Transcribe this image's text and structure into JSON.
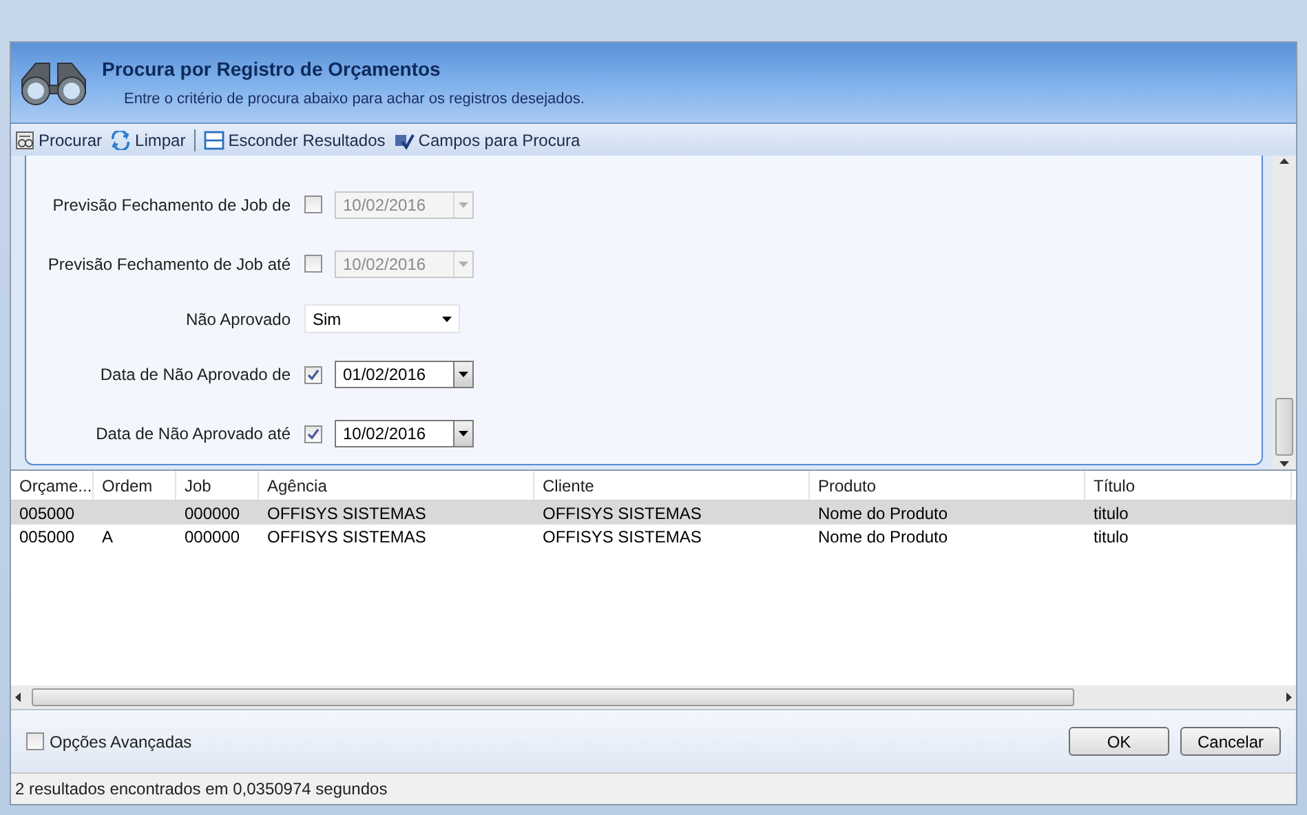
{
  "header": {
    "title": "Procura por Registro de Orçamentos",
    "subtitle": "Entre o critério de procura abaixo para achar os registros desejados."
  },
  "toolbar": [
    {
      "label": "Procurar"
    },
    {
      "label": "Limpar"
    },
    {
      "label": "Esconder Resultados"
    },
    {
      "label": "Campos para Procura"
    }
  ],
  "criteria": [
    {
      "kind": "date",
      "label": "Previsão Fechamento de Job de",
      "checked": false,
      "value": "10/02/2016"
    },
    {
      "kind": "date",
      "label": "Previsão Fechamento de Job até",
      "checked": false,
      "value": "10/02/2016"
    },
    {
      "kind": "combo",
      "label": "Não Aprovado",
      "value": "Sim"
    },
    {
      "kind": "date",
      "label": "Data de Não Aprovado de",
      "checked": true,
      "value": "01/02/2016"
    },
    {
      "kind": "date",
      "label": "Data de Não Aprovado até",
      "checked": true,
      "value": "10/02/2016"
    }
  ],
  "table": {
    "columns": [
      "Orçame...",
      "Ordem",
      "Job",
      "Agência",
      "Cliente",
      "Produto",
      "Título"
    ],
    "rows": [
      {
        "selected": true,
        "cells": [
          "005000",
          "",
          "000000",
          "OFFISYS SISTEMAS",
          "OFFISYS SISTEMAS",
          "Nome do Produto",
          "titulo"
        ]
      },
      {
        "selected": false,
        "cells": [
          "005000",
          "A",
          "000000",
          "OFFISYS SISTEMAS",
          "OFFISYS SISTEMAS",
          "Nome do Produto",
          "titulo"
        ]
      }
    ]
  },
  "advanced_options": {
    "label": "Opções Avançadas",
    "checked": false
  },
  "buttons": [
    "OK",
    "Cancelar"
  ],
  "status_bar": "2 resultados encontrados em 0,0350974 segundos"
}
